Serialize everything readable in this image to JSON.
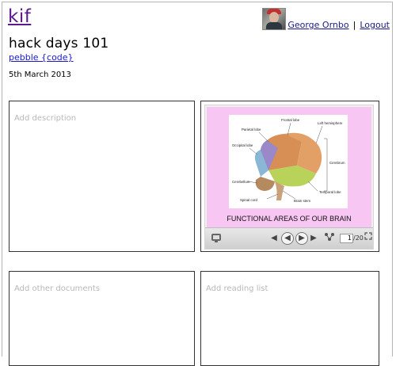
{
  "header": {
    "logo": "kif",
    "user_name": "George Ornbo",
    "separator": "|",
    "logout_label": "Logout"
  },
  "page": {
    "title": "hack days 101",
    "project_link": "pebble {code}",
    "date": "5th March 2013"
  },
  "panels": {
    "description_placeholder": "Add description",
    "documents_placeholder": "Add other documents",
    "reading_list_placeholder": "Add reading list"
  },
  "slideshow": {
    "caption": "FUNCTIONAL AREAS OF OUR BRAIN",
    "diagram_labels": {
      "frontal": "Frontal lobe",
      "left_hemisphere": "Left hemisphere",
      "parietal": "Parietal lobe",
      "occipital": "Occipital lobe",
      "cerebrum": "Cerebrum",
      "cerebellum": "Cerebellum",
      "temporal": "Temporal lobe",
      "spinal": "Spinal cord",
      "stem": "Brain stem"
    },
    "current_page": "1",
    "total_pages": "/20",
    "icons": {
      "logo": "speakerdeck-icon",
      "first": "skip-back-icon",
      "prev": "prev-icon",
      "next": "next-icon",
      "last": "skip-forward-icon",
      "share": "share-icon",
      "fullscreen": "fullscreen-icon"
    }
  }
}
